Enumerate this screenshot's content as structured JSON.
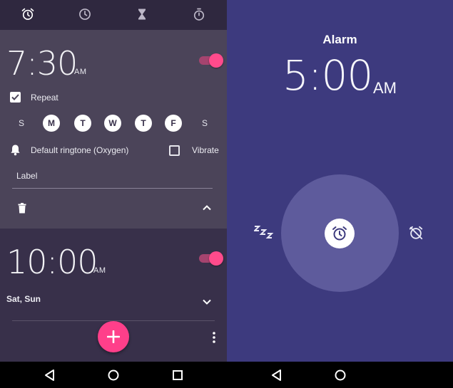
{
  "left": {
    "tabs": [
      {
        "icon": "alarm-icon",
        "active": true
      },
      {
        "icon": "clock-icon",
        "active": false
      },
      {
        "icon": "hourglass-timer-icon",
        "active": false
      },
      {
        "icon": "stopwatch-icon",
        "active": false
      }
    ],
    "alarm1": {
      "time": "7:30",
      "ampm": "AM",
      "enabled": true,
      "repeat_checked": true,
      "repeat_label": "Repeat",
      "days": [
        {
          "letter": "S",
          "on": false
        },
        {
          "letter": "M",
          "on": true
        },
        {
          "letter": "T",
          "on": true
        },
        {
          "letter": "W",
          "on": true
        },
        {
          "letter": "T",
          "on": true
        },
        {
          "letter": "F",
          "on": true
        },
        {
          "letter": "S",
          "on": false
        }
      ],
      "ringtone_label": "Default ringtone (Oxygen)",
      "vibrate_label": "Vibrate",
      "vibrate_checked": false,
      "label_placeholder": "Label"
    },
    "alarm2": {
      "time": "10:00",
      "ampm": "AM",
      "enabled": true,
      "days_summary": "Sat, Sun"
    }
  },
  "right": {
    "title": "Alarm",
    "time": "5:00",
    "ampm": "AM"
  },
  "colors": {
    "accent": "#ff4b8c",
    "left_bg": "#38304a",
    "expanded_bg": "#4b4459",
    "right_bg": "#3d3a7e",
    "ring_circle": "#5e5b9c"
  }
}
